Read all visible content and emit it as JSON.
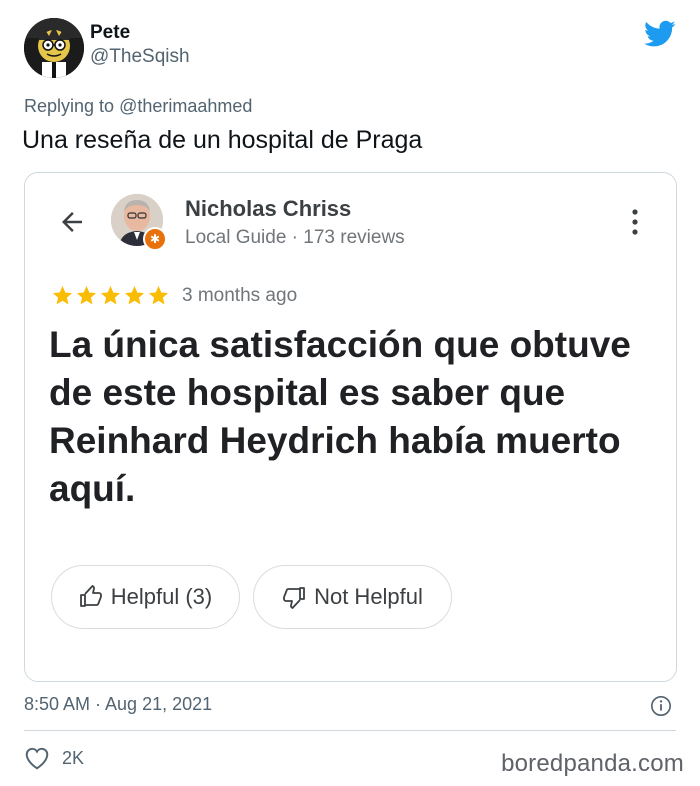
{
  "tweet": {
    "author_name": "Pete",
    "author_handle": "@TheSqish",
    "replying_prefix": "Replying to ",
    "replying_to": "@therimaahmed",
    "text": "Una reseña de un hospital de Praga",
    "timestamp": "8:50 AM · Aug 21, 2021",
    "like_count": "2K",
    "brand_color": "#1d9bf0"
  },
  "review_card": {
    "reviewer_name": "Nicholas Chriss",
    "reviewer_meta": "Local Guide · 173 reviews",
    "star_rating": 5,
    "star_color": "#fbbc04",
    "review_age": "3 months ago",
    "review_text": "La única satisfacción que obtuve de este hospital es saber que Reinhard Heydrich había muerto aquí.",
    "helpful_label": "Helpful (3)",
    "not_helpful_label": "Not Helpful"
  },
  "icons": {
    "header": "twitter-bird-icon",
    "back": "back-arrow-icon",
    "menu": "more-vert-icon",
    "thumbs_up": "thumbs-up-icon",
    "thumbs_down": "thumbs-down-icon",
    "info": "info-icon",
    "like": "heart-icon"
  },
  "watermark": "boredpanda.com"
}
